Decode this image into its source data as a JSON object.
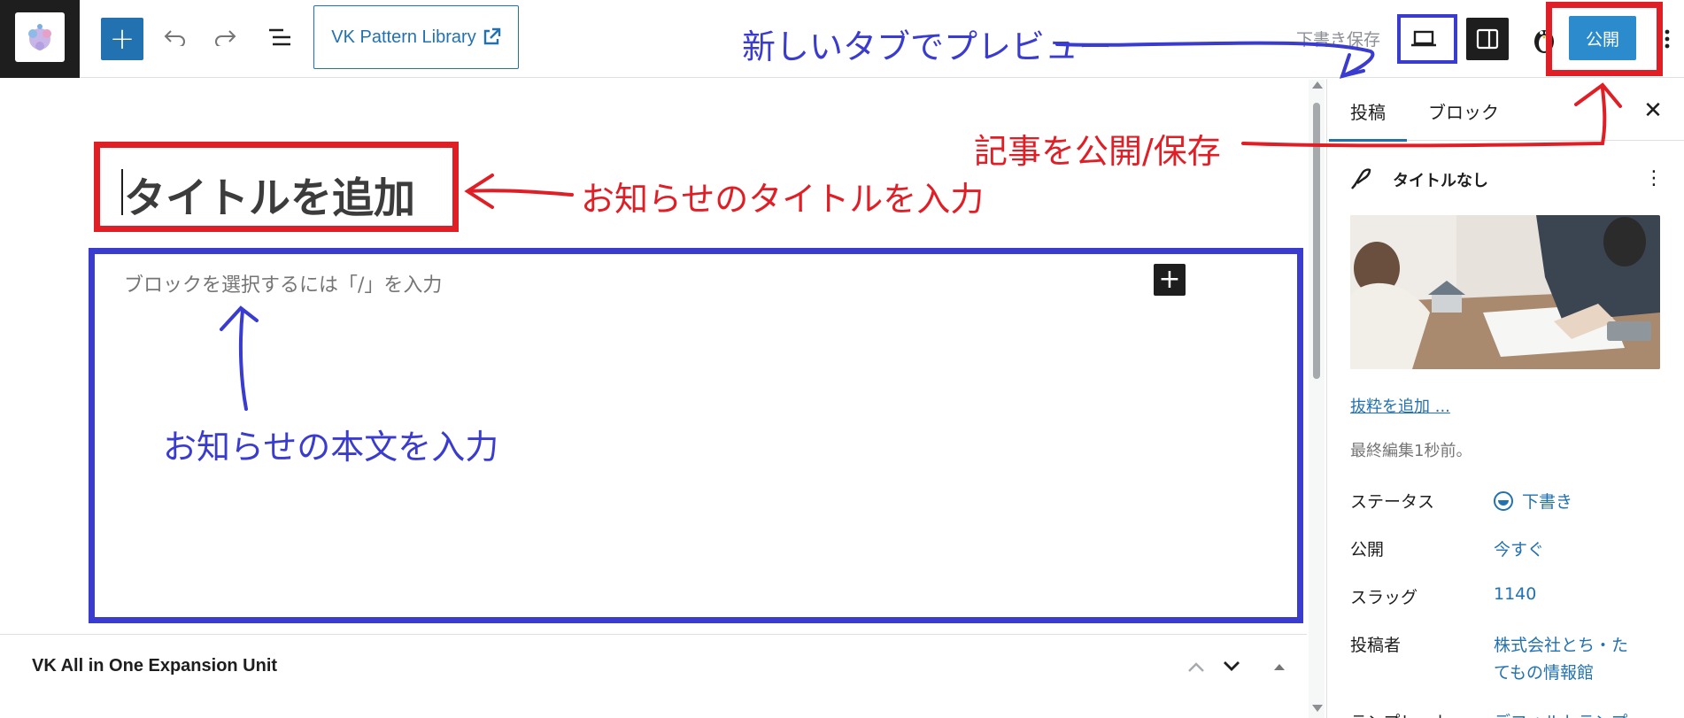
{
  "toolbar": {
    "pattern_library_label": "VK Pattern Library",
    "save_draft_label": "下書き保存",
    "publish_label": "公開"
  },
  "editor": {
    "title_placeholder": "タイトルを追加",
    "content_placeholder": "ブロックを選択するには「/」を入力"
  },
  "annotations": {
    "preview": "新しいタブでプレビュー",
    "publish": "記事を公開/保存",
    "title": "お知らせのタイトルを入力",
    "content": "お知らせの本文を入力",
    "colors": {
      "red": "#e01e26",
      "blue": "#3a3bcf"
    }
  },
  "metabox": {
    "title": "VK All in One Expansion Unit"
  },
  "sidebar": {
    "tabs": [
      {
        "label": "投稿",
        "active": true
      },
      {
        "label": "ブロック",
        "active": false
      }
    ],
    "post_title": "タイトルなし",
    "excerpt_link": "抜粋を追加 ...",
    "last_edited": "最終編集1秒前。",
    "rows": [
      {
        "label": "ステータス",
        "value": "下書き"
      },
      {
        "label": "公開",
        "value": "今すぐ"
      },
      {
        "label": "スラッグ",
        "value": "1140"
      },
      {
        "label": "投稿者",
        "value_line1": "株式会社とち・た",
        "value_line2": "てもの情報館"
      },
      {
        "label": "テンプレート",
        "value": "デフォルトテンプ"
      }
    ]
  },
  "icons": {
    "add": "plus-icon",
    "undo": "undo-icon",
    "redo": "redo-icon",
    "list_view": "list-view-icon",
    "external": "external-link-icon",
    "preview": "laptop-preview-icon",
    "settings": "sidebar-toggle-icon",
    "more": "more-vertical-icon"
  }
}
